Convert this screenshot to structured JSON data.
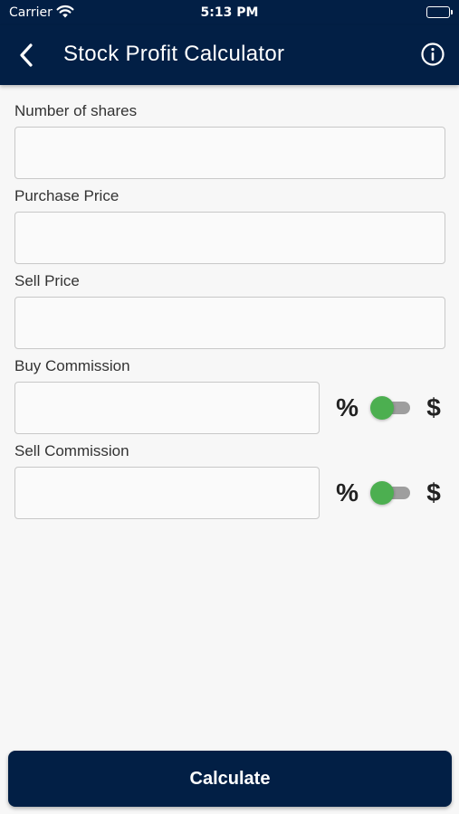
{
  "status_bar": {
    "carrier": "Carrier",
    "time": "5:13 PM"
  },
  "nav": {
    "title": "Stock Profit Calculator",
    "back_icon": "chevron-left-icon",
    "info_icon": "info-icon"
  },
  "form": {
    "shares": {
      "label": "Number of shares",
      "value": "",
      "placeholder": ""
    },
    "purchase_price": {
      "label": "Purchase Price",
      "value": "",
      "placeholder": ""
    },
    "sell_price": {
      "label": "Sell Price",
      "value": "",
      "placeholder": ""
    },
    "buy_commission": {
      "label": "Buy Commission",
      "value": "",
      "placeholder": "",
      "percent_label": "%",
      "dollar_label": "$"
    },
    "sell_commission": {
      "label": "Sell Commission",
      "value": "",
      "placeholder": "",
      "percent_label": "%",
      "dollar_label": "$"
    }
  },
  "calculate_label": "Calculate",
  "colors": {
    "primary": "#021f45",
    "background": "#f7f7f7",
    "toggle_knob": "#4caf50",
    "toggle_track": "#9e9e9e"
  }
}
